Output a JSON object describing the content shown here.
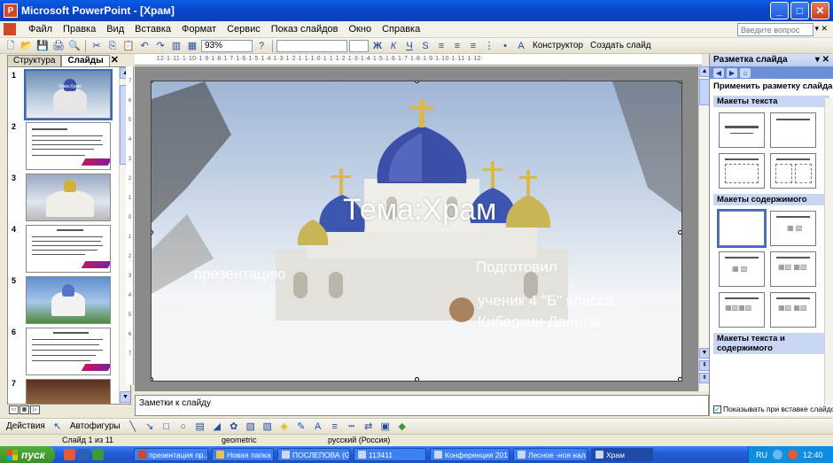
{
  "window": {
    "title": "Microsoft PowerPoint - [Храм]",
    "icon_label": "P"
  },
  "menu": {
    "items": [
      "Файл",
      "Правка",
      "Вид",
      "Вставка",
      "Формат",
      "Сервис",
      "Показ слайдов",
      "Окно",
      "Справка"
    ],
    "ask_placeholder": "Введите вопрос"
  },
  "toolbar": {
    "zoom": "93%",
    "designer_label": "Конструктор",
    "create_slide_label": "Создать слайд"
  },
  "left_panel": {
    "tabs": [
      "Структура",
      "Слайды"
    ],
    "active_tab": "Слайды",
    "slide_numbers": [
      "1",
      "2",
      "3",
      "4",
      "5",
      "6",
      "7"
    ],
    "thumb1_caption": "Тема:Храм"
  },
  "ruler": {
    "horizontal": "·12·1·11·1·10·1·9·1·8·1·7·1·6·1·5·1·4·1·3·1·2·1·1·1·0·1·1·1·2·1·3·1·4·1·5·1·6·1·7·1·8·1·9·1·10·1·11·1·12·",
    "vertical": [
      "7",
      "6",
      "5",
      "4",
      "3",
      "2",
      "1",
      "0",
      "1",
      "2",
      "3",
      "4",
      "5",
      "6",
      "7"
    ]
  },
  "slide": {
    "title": "Тема:Храм",
    "left_text": "презентацию",
    "right_line1": "Подготовил",
    "right_line2": "ученик 4 \"Б\" класса",
    "right_line3": "Киберкин Данила"
  },
  "notes": {
    "placeholder": "Заметки к слайду"
  },
  "task_pane": {
    "title": "Разметка слайда",
    "apply_label": "Применить разметку слайда:",
    "section_text": "Макеты текста",
    "section_content": "Макеты содержимого",
    "section_text_content": "Макеты текста и содержимого",
    "show_on_insert_label": "Показывать при вставке слайдов",
    "show_on_insert_checked": true
  },
  "drawing_toolbar": {
    "actions_label": "Действия",
    "autoshapes_label": "Автофигуры"
  },
  "status": {
    "slide_counter": "Слайд 1 из 11",
    "design": "geometric",
    "language": "русский (Россия)"
  },
  "taskbar": {
    "start_label": "пуск",
    "tasks": [
      {
        "label": "презентация пр...",
        "color": "#d24726"
      },
      {
        "label": "Новая папка",
        "color": "#f2c14e"
      },
      {
        "label": "ПОСЛЕПОВА (G:)",
        "color": "#cfd8e8"
      },
      {
        "label": "113411",
        "color": "#2b5fb8"
      },
      {
        "label": "Конференция 2017",
        "color": "#2b5fb8"
      },
      {
        "label": "Лесное -ноя нал...",
        "color": "#2b5fb8"
      },
      {
        "label": "Храм",
        "color": "#2b5fb8"
      }
    ],
    "active_task": "Храм",
    "lang": "RU",
    "clock": "12:40"
  },
  "colors": {
    "titlebar": "#0a5ce6",
    "slide_text": "#ffffff",
    "accent": "#316ac5"
  }
}
